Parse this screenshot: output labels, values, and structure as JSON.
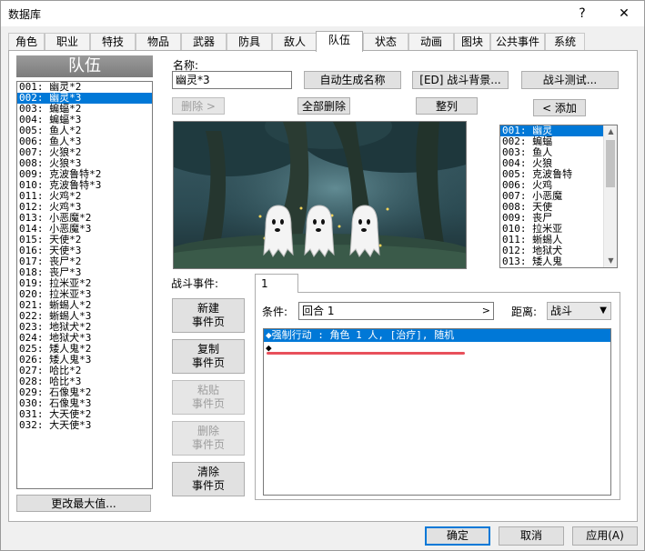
{
  "window": {
    "title": "数据库",
    "help_label": "?",
    "close_label": "✕"
  },
  "tabs": [
    "角色",
    "职业",
    "特技",
    "物品",
    "武器",
    "防具",
    "敌人",
    "队伍",
    "状态",
    "动画",
    "图块",
    "公共事件",
    "系统"
  ],
  "active_tab": "队伍",
  "left_panel": {
    "header": "队伍",
    "items": [
      "001: 幽灵*2",
      "002: 幽灵*3",
      "003: 蝙蝠*2",
      "004: 蝙蝠*3",
      "005: 鱼人*2",
      "006: 鱼人*3",
      "007: 火狼*2",
      "008: 火狼*3",
      "009: 克波鲁特*2",
      "010: 克波鲁特*3",
      "011: 火鸡*2",
      "012: 火鸡*3",
      "013: 小恶魔*2",
      "014: 小恶魔*3",
      "015: 天使*2",
      "016: 天使*3",
      "017: 丧尸*2",
      "018: 丧尸*3",
      "019: 拉米亚*2",
      "020: 拉米亚*3",
      "021: 蜥蜴人*2",
      "022: 蜥蜴人*3",
      "023: 地狱犬*2",
      "024: 地狱犬*3",
      "025: 矮人鬼*2",
      "026: 矮人鬼*3",
      "027: 哈比*2",
      "028: 哈比*3",
      "029: 石像鬼*2",
      "030: 石像鬼*3",
      "031: 大天使*2",
      "032: 大天使*3"
    ],
    "selected_index": 1,
    "change_max_label": "更改最大值..."
  },
  "name_section": {
    "label": "名称:",
    "value": "幽灵*3",
    "auto_name_label": "自动生成名称",
    "battle_bg_label": "[ED] 战斗背景...",
    "battle_test_label": "战斗测试..."
  },
  "member_buttons": {
    "remove_label": "删除 >",
    "remove_all_label": "全部删除",
    "arrange_label": "整列",
    "add_label": "< 添加"
  },
  "enemy_list": {
    "items": [
      "001: 幽灵",
      "002: 蝙蝠",
      "003: 鱼人",
      "004: 火狼",
      "005: 克波鲁特",
      "006: 火鸡",
      "007: 小恶魔",
      "008: 天使",
      "009: 丧尸",
      "010: 拉米亚",
      "011: 蜥蜴人",
      "012: 地狱犬",
      "013: 矮人鬼"
    ],
    "selected_index": 0
  },
  "battle_event": {
    "label": "战斗事件:",
    "page_tab": "1",
    "new_page_label": [
      "新建",
      "事件页"
    ],
    "copy_page_label": [
      "复制",
      "事件页"
    ],
    "paste_page_label": [
      "粘贴",
      "事件页"
    ],
    "delete_page_label": [
      "删除",
      "事件页"
    ],
    "clear_page_label": [
      "清除",
      "事件页"
    ],
    "condition_label": "条件:",
    "condition_value": "回合 1",
    "span_label": "距离:",
    "span_value": "战斗",
    "commands": [
      "◆强制行动 : 角色 1 人, [治疗], 随机",
      "◆"
    ]
  },
  "footer": {
    "ok_label": "确定",
    "cancel_label": "取消",
    "apply_label": "应用(A)"
  },
  "colors": {
    "selection": "#0078d7",
    "annotation_underline": "#e8505b"
  }
}
